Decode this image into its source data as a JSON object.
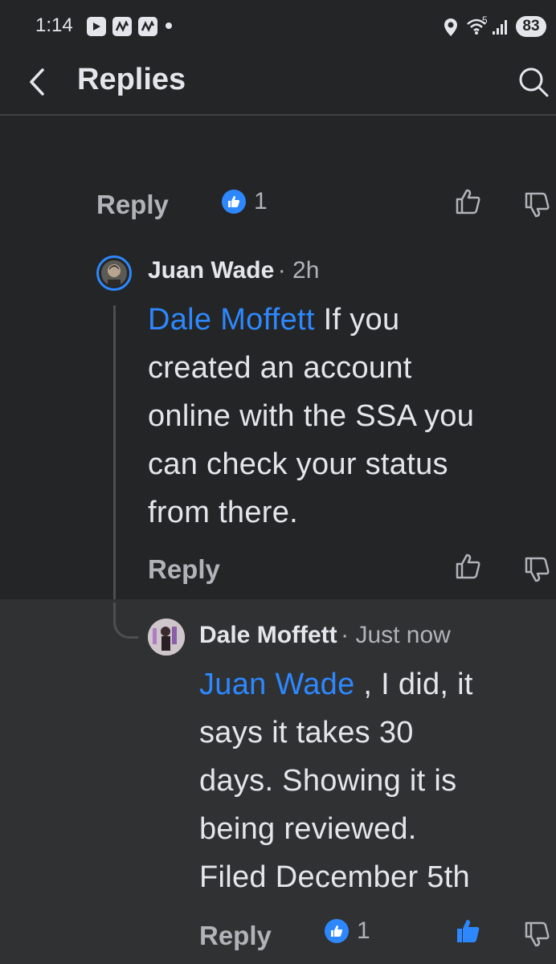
{
  "status_bar": {
    "time": "1:14",
    "network": "5",
    "battery": "83"
  },
  "header": {
    "title": "Replies"
  },
  "top_actions": {
    "reply_label": "Reply",
    "like_count": "1"
  },
  "comments": [
    {
      "author": "Juan Wade",
      "time": "· 2h",
      "mention": "Dale Moffett",
      "lines": [
        "If you",
        "created an account",
        "online with the SSA you",
        "can check your status",
        "from there."
      ],
      "reply_label": "Reply"
    },
    {
      "author": "Dale Moffett",
      "time": "· Just now",
      "mention": "Juan Wade",
      "lines": [
        ", I did, it",
        "says it takes 30",
        "days. Showing it is",
        "being reviewed.",
        "Filed December 5th"
      ],
      "reply_label": "Reply",
      "like_count": "1"
    }
  ],
  "colors": {
    "background": "#242526",
    "highlight": "#303132",
    "mention": "#2d88ff",
    "text": "#e4e6eb",
    "secondary": "#b0b3b8"
  }
}
